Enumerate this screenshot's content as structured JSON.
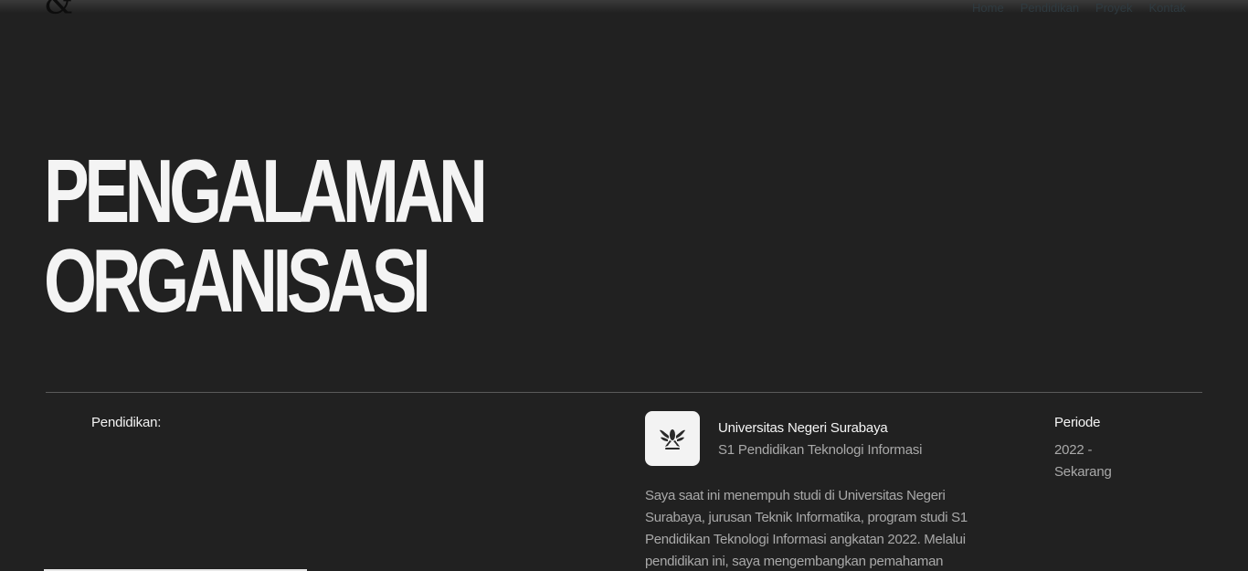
{
  "header": {
    "logo_glyph": "&",
    "nav": [
      "Home",
      "Pendidikan",
      "Proyek",
      "Kontak"
    ]
  },
  "hero": {
    "line1": "PENGALAMAN",
    "line2": "ORGANISASI"
  },
  "education": {
    "section_label": "Pendidikan:",
    "institution": "Universitas Negeri Surabaya",
    "program": "S1 Pendidikan Teknologi Informasi",
    "period_label": "Periode",
    "period_value": "2022 - Sekarang",
    "description": "Saya saat ini menempuh studi di Universitas Negeri Surabaya, jurusan Teknik Informatika, program studi S1 Pendidikan Teknologi Informasi angkatan 2022. Melalui pendidikan ini, saya mengembangkan pemahaman",
    "logo_icon": "university-emblem-icon"
  },
  "colors": {
    "background": "#212121",
    "text_primary": "#f4f4f4",
    "text_muted": "#a9a9a9",
    "divider": "#5a5a5a"
  }
}
